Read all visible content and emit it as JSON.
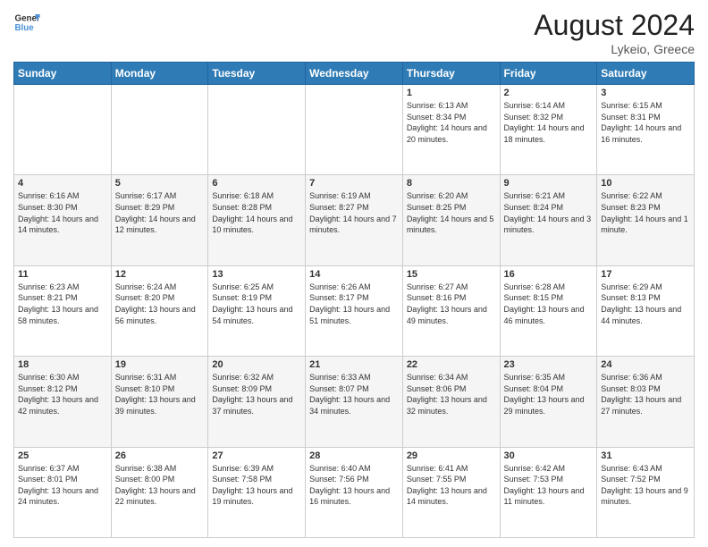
{
  "header": {
    "logo_line1": "General",
    "logo_line2": "Blue",
    "month_year": "August 2024",
    "location": "Lykeio, Greece"
  },
  "weekdays": [
    "Sunday",
    "Monday",
    "Tuesday",
    "Wednesday",
    "Thursday",
    "Friday",
    "Saturday"
  ],
  "weeks": [
    [
      {
        "day": "",
        "text": ""
      },
      {
        "day": "",
        "text": ""
      },
      {
        "day": "",
        "text": ""
      },
      {
        "day": "",
        "text": ""
      },
      {
        "day": "1",
        "text": "Sunrise: 6:13 AM\nSunset: 8:34 PM\nDaylight: 14 hours and 20 minutes."
      },
      {
        "day": "2",
        "text": "Sunrise: 6:14 AM\nSunset: 8:32 PM\nDaylight: 14 hours and 18 minutes."
      },
      {
        "day": "3",
        "text": "Sunrise: 6:15 AM\nSunset: 8:31 PM\nDaylight: 14 hours and 16 minutes."
      }
    ],
    [
      {
        "day": "4",
        "text": "Sunrise: 6:16 AM\nSunset: 8:30 PM\nDaylight: 14 hours and 14 minutes."
      },
      {
        "day": "5",
        "text": "Sunrise: 6:17 AM\nSunset: 8:29 PM\nDaylight: 14 hours and 12 minutes."
      },
      {
        "day": "6",
        "text": "Sunrise: 6:18 AM\nSunset: 8:28 PM\nDaylight: 14 hours and 10 minutes."
      },
      {
        "day": "7",
        "text": "Sunrise: 6:19 AM\nSunset: 8:27 PM\nDaylight: 14 hours and 7 minutes."
      },
      {
        "day": "8",
        "text": "Sunrise: 6:20 AM\nSunset: 8:25 PM\nDaylight: 14 hours and 5 minutes."
      },
      {
        "day": "9",
        "text": "Sunrise: 6:21 AM\nSunset: 8:24 PM\nDaylight: 14 hours and 3 minutes."
      },
      {
        "day": "10",
        "text": "Sunrise: 6:22 AM\nSunset: 8:23 PM\nDaylight: 14 hours and 1 minute."
      }
    ],
    [
      {
        "day": "11",
        "text": "Sunrise: 6:23 AM\nSunset: 8:21 PM\nDaylight: 13 hours and 58 minutes."
      },
      {
        "day": "12",
        "text": "Sunrise: 6:24 AM\nSunset: 8:20 PM\nDaylight: 13 hours and 56 minutes."
      },
      {
        "day": "13",
        "text": "Sunrise: 6:25 AM\nSunset: 8:19 PM\nDaylight: 13 hours and 54 minutes."
      },
      {
        "day": "14",
        "text": "Sunrise: 6:26 AM\nSunset: 8:17 PM\nDaylight: 13 hours and 51 minutes."
      },
      {
        "day": "15",
        "text": "Sunrise: 6:27 AM\nSunset: 8:16 PM\nDaylight: 13 hours and 49 minutes."
      },
      {
        "day": "16",
        "text": "Sunrise: 6:28 AM\nSunset: 8:15 PM\nDaylight: 13 hours and 46 minutes."
      },
      {
        "day": "17",
        "text": "Sunrise: 6:29 AM\nSunset: 8:13 PM\nDaylight: 13 hours and 44 minutes."
      }
    ],
    [
      {
        "day": "18",
        "text": "Sunrise: 6:30 AM\nSunset: 8:12 PM\nDaylight: 13 hours and 42 minutes."
      },
      {
        "day": "19",
        "text": "Sunrise: 6:31 AM\nSunset: 8:10 PM\nDaylight: 13 hours and 39 minutes."
      },
      {
        "day": "20",
        "text": "Sunrise: 6:32 AM\nSunset: 8:09 PM\nDaylight: 13 hours and 37 minutes."
      },
      {
        "day": "21",
        "text": "Sunrise: 6:33 AM\nSunset: 8:07 PM\nDaylight: 13 hours and 34 minutes."
      },
      {
        "day": "22",
        "text": "Sunrise: 6:34 AM\nSunset: 8:06 PM\nDaylight: 13 hours and 32 minutes."
      },
      {
        "day": "23",
        "text": "Sunrise: 6:35 AM\nSunset: 8:04 PM\nDaylight: 13 hours and 29 minutes."
      },
      {
        "day": "24",
        "text": "Sunrise: 6:36 AM\nSunset: 8:03 PM\nDaylight: 13 hours and 27 minutes."
      }
    ],
    [
      {
        "day": "25",
        "text": "Sunrise: 6:37 AM\nSunset: 8:01 PM\nDaylight: 13 hours and 24 minutes."
      },
      {
        "day": "26",
        "text": "Sunrise: 6:38 AM\nSunset: 8:00 PM\nDaylight: 13 hours and 22 minutes."
      },
      {
        "day": "27",
        "text": "Sunrise: 6:39 AM\nSunset: 7:58 PM\nDaylight: 13 hours and 19 minutes."
      },
      {
        "day": "28",
        "text": "Sunrise: 6:40 AM\nSunset: 7:56 PM\nDaylight: 13 hours and 16 minutes."
      },
      {
        "day": "29",
        "text": "Sunrise: 6:41 AM\nSunset: 7:55 PM\nDaylight: 13 hours and 14 minutes."
      },
      {
        "day": "30",
        "text": "Sunrise: 6:42 AM\nSunset: 7:53 PM\nDaylight: 13 hours and 11 minutes."
      },
      {
        "day": "31",
        "text": "Sunrise: 6:43 AM\nSunset: 7:52 PM\nDaylight: 13 hours and 9 minutes."
      }
    ]
  ]
}
